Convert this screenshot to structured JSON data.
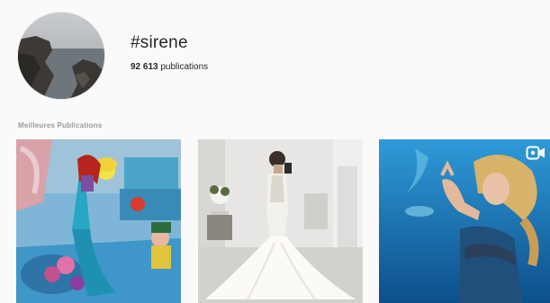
{
  "header": {
    "hashtag": "#sirene",
    "post_count_number": "92 613",
    "post_count_label": " publications"
  },
  "section": {
    "top_posts_label": "Meilleures Publications"
  },
  "posts": [
    {
      "kind": "image",
      "subject": "parade-float-mermaid"
    },
    {
      "kind": "image",
      "subject": "white-mermaid-gown"
    },
    {
      "kind": "video",
      "subject": "underwater-mermaid",
      "badge_icon": "video-camera-icon"
    }
  ],
  "colors": {
    "background": "#fafafa",
    "text": "#262626",
    "muted": "#999999",
    "underwater_blue": "#1a7fc4"
  }
}
